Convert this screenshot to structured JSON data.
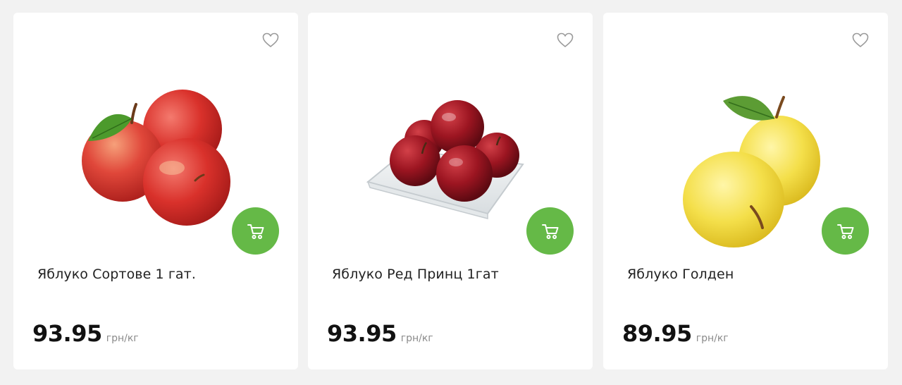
{
  "products": [
    {
      "name": "Яблуко Сортове 1 гат.",
      "price": "93.95",
      "unit": "грн/кг",
      "image": "red-apples",
      "favorite_icon": "heart-outline-icon",
      "cart_icon": "cart-icon"
    },
    {
      "name": "Яблуко Ред Принц 1гат",
      "price": "93.95",
      "unit": "грн/кг",
      "image": "dark-red-apples-in-glass-bowl",
      "favorite_icon": "heart-outline-icon",
      "cart_icon": "cart-icon"
    },
    {
      "name": "Яблуко Голден",
      "price": "89.95",
      "unit": "грн/кг",
      "image": "yellow-golden-apples",
      "favorite_icon": "heart-outline-icon",
      "cart_icon": "cart-icon"
    }
  ],
  "colors": {
    "accent": "#65b947",
    "page_bg": "#f2f2f2",
    "card_bg": "#ffffff"
  }
}
